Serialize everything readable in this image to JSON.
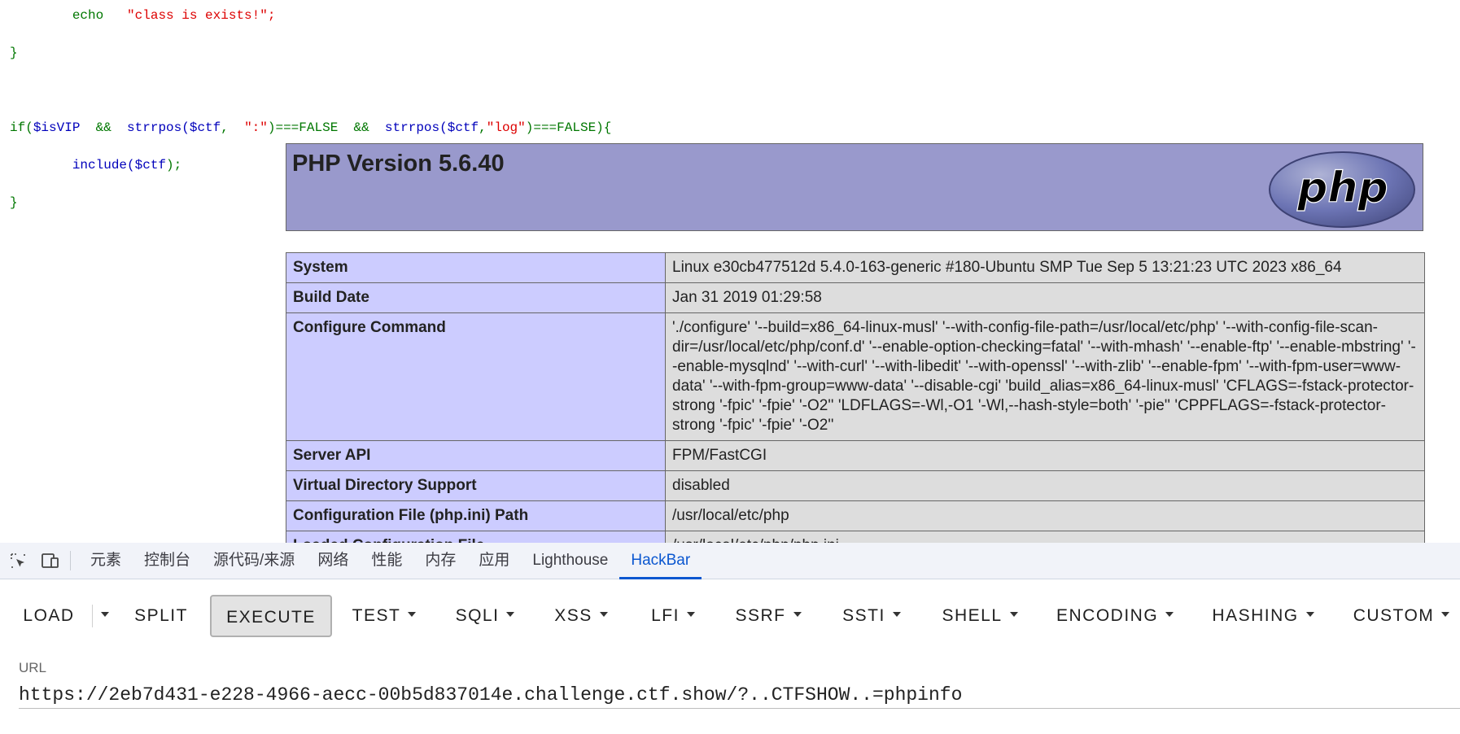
{
  "code": {
    "line1": {
      "echo": "echo",
      "str": "\"class is exists!\";"
    },
    "line2": "}",
    "line4": {
      "kw_if": "if(",
      "var_isvip": "$isVIP",
      "op_and1": "&&",
      "fn1": "strrpos(",
      "var_ctf1": "$ctf",
      "comma1": ",",
      "str1": "\":\"",
      "cmp1": ")===FALSE",
      "op_and2": "&&",
      "fn2": "strrpos(",
      "var_ctf2": "$ctf",
      "comma2": ",",
      "str2": "\"log\"",
      "cmp2": ")===FALSE){"
    },
    "line5": {
      "fn": "include(",
      "var": "$ctf",
      "end": ");"
    },
    "line6": "}"
  },
  "phpinfo": {
    "title": "PHP Version 5.6.40",
    "logo_text": "php",
    "rows": [
      {
        "key": "System",
        "value": "Linux e30cb477512d 5.4.0-163-generic #180-Ubuntu SMP Tue Sep 5 13:21:23 UTC 2023 x86_64"
      },
      {
        "key": "Build Date",
        "value": "Jan 31 2019 01:29:58"
      },
      {
        "key": "Configure Command",
        "value": "'./configure' '--build=x86_64-linux-musl' '--with-config-file-path=/usr/local/etc/php' '--with-config-file-scan-dir=/usr/local/etc/php/conf.d' '--enable-option-checking=fatal' '--with-mhash' '--enable-ftp' '--enable-mbstring' '--enable-mysqlnd' '--with-curl' '--with-libedit' '--with-openssl' '--with-zlib' '--enable-fpm' '--with-fpm-user=www-data' '--with-fpm-group=www-data' '--disable-cgi' 'build_alias=x86_64-linux-musl' 'CFLAGS=-fstack-protector-strong '-fpic' '-fpie' '-O2'' 'LDFLAGS=-Wl,-O1 '-Wl,--hash-style=both' '-pie'' 'CPPFLAGS=-fstack-protector-strong '-fpic' '-fpie' '-O2''"
      },
      {
        "key": "Server API",
        "value": "FPM/FastCGI"
      },
      {
        "key": "Virtual Directory Support",
        "value": "disabled"
      },
      {
        "key": "Configuration File (php.ini) Path",
        "value": "/usr/local/etc/php"
      },
      {
        "key": "Loaded Configuration File",
        "value": "/usr/local/etc/php/php.ini"
      }
    ]
  },
  "devtools": {
    "icons": {
      "inspect": "inspect-element-icon",
      "device": "device-toggle-icon"
    },
    "tabs": [
      "元素",
      "控制台",
      "源代码/来源",
      "网络",
      "性能",
      "内存",
      "应用",
      "Lighthouse",
      "HackBar"
    ],
    "active_tab": "HackBar"
  },
  "hackbar": {
    "buttons": {
      "load": "LOAD",
      "split": "SPLIT",
      "execute": "EXECUTE",
      "test": "TEST",
      "sqli": "SQLI",
      "xss": "XSS",
      "lfi": "LFI",
      "ssrf": "SSRF",
      "ssti": "SSTI",
      "shell": "SHELL",
      "encoding": "ENCODING",
      "hashing": "HASHING",
      "custom": "CUSTOM"
    },
    "url_label": "URL",
    "url_value": "https://2eb7d431-e228-4966-aecc-00b5d837014e.challenge.ctf.show/?..CTFSHOW..=phpinfo"
  }
}
